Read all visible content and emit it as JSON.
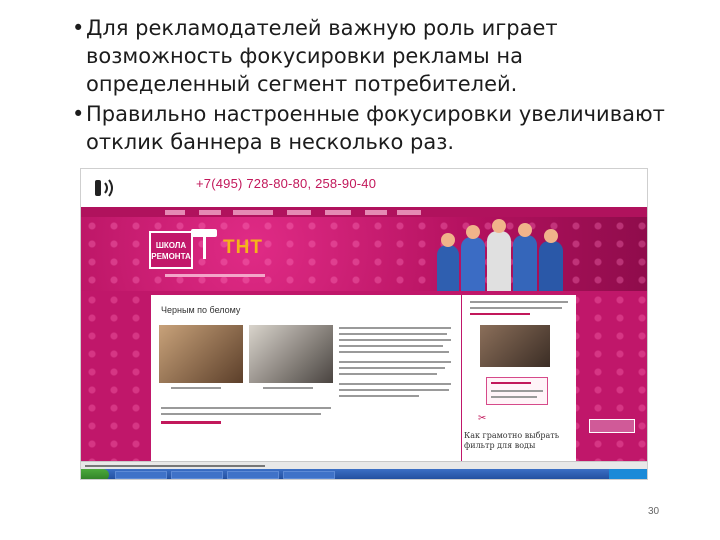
{
  "bullets": [
    "Для рекламодателей важную роль играет возможность фокусировки рекламы на определенный сегмент потребителей.",
    "Правильно настроенные фокусировки увеличивают отклик баннера в несколько раз."
  ],
  "screenshot": {
    "phone": "+7(495) 728-80-80, 258-90-40",
    "logo_line1": "ШКОЛА",
    "logo_line2": "РЕМОНТА",
    "channel_logo": "ТНТ",
    "article_title": "Черным по белому",
    "side_question": "Как грамотно выбрать фильтр для воды",
    "colors": {
      "brand_pink": "#c2185b",
      "banner": "#b4115f",
      "channel_orange": "#f5b41a"
    }
  },
  "page_number": "30"
}
